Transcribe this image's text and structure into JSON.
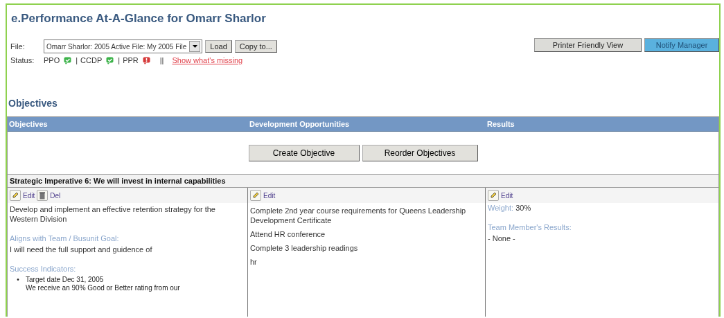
{
  "title": "e.Performance At-A-Glance for Omarr Sharlor",
  "file": {
    "label": "File:",
    "value": "Omarr Sharlor: 2005 Active File: My 2005 File",
    "buttons": [
      "Load",
      "Copy to..."
    ]
  },
  "actions": [
    {
      "label": "Printer Friendly View",
      "disabled": false
    },
    {
      "label": "Notify Manager",
      "disabled": true
    }
  ],
  "status": {
    "label": "Status:",
    "items": [
      {
        "label": "PPO",
        "complete": true
      },
      {
        "label": "CCDP",
        "complete": true
      },
      {
        "label": "PPR",
        "complete": false
      }
    ],
    "item_separator": "|",
    "separator": "||",
    "link": "Show what's missing"
  },
  "section_title": "Objectives",
  "table": {
    "columns": [
      "Objectives",
      "Development Opportunities",
      "Results"
    ],
    "buttons": [
      "Create Objective",
      "Reorder Objectives"
    ],
    "group": "Strategic Imperative 6: We will invest in internal capabilities",
    "objective": {
      "edit": "Edit",
      "delete": "Del",
      "text": "Develop and implement an effective retention strategy for the Western Division",
      "goal_label": "Aligns with Team / Busunit Goal:",
      "goal": "I will need the full support and guidence of",
      "indicators_label": "Success Indicators:",
      "bullet": "•",
      "indicators": [
        "Target date Dec 31, 2005",
        "We receive an 90% Good or Better rating from our"
      ]
    },
    "development": {
      "edit": "Edit",
      "items": [
        "Complete 2nd year course requirements for Queens Leadership Development Certificate",
        "Attend HR conference",
        "Complete 3 leadership readings",
        "hr"
      ]
    },
    "results": {
      "edit": "Edit",
      "weight_label": "Weight:",
      "weight": "30%",
      "results_label": "Team Member's Results:",
      "results": "- None -"
    }
  }
}
